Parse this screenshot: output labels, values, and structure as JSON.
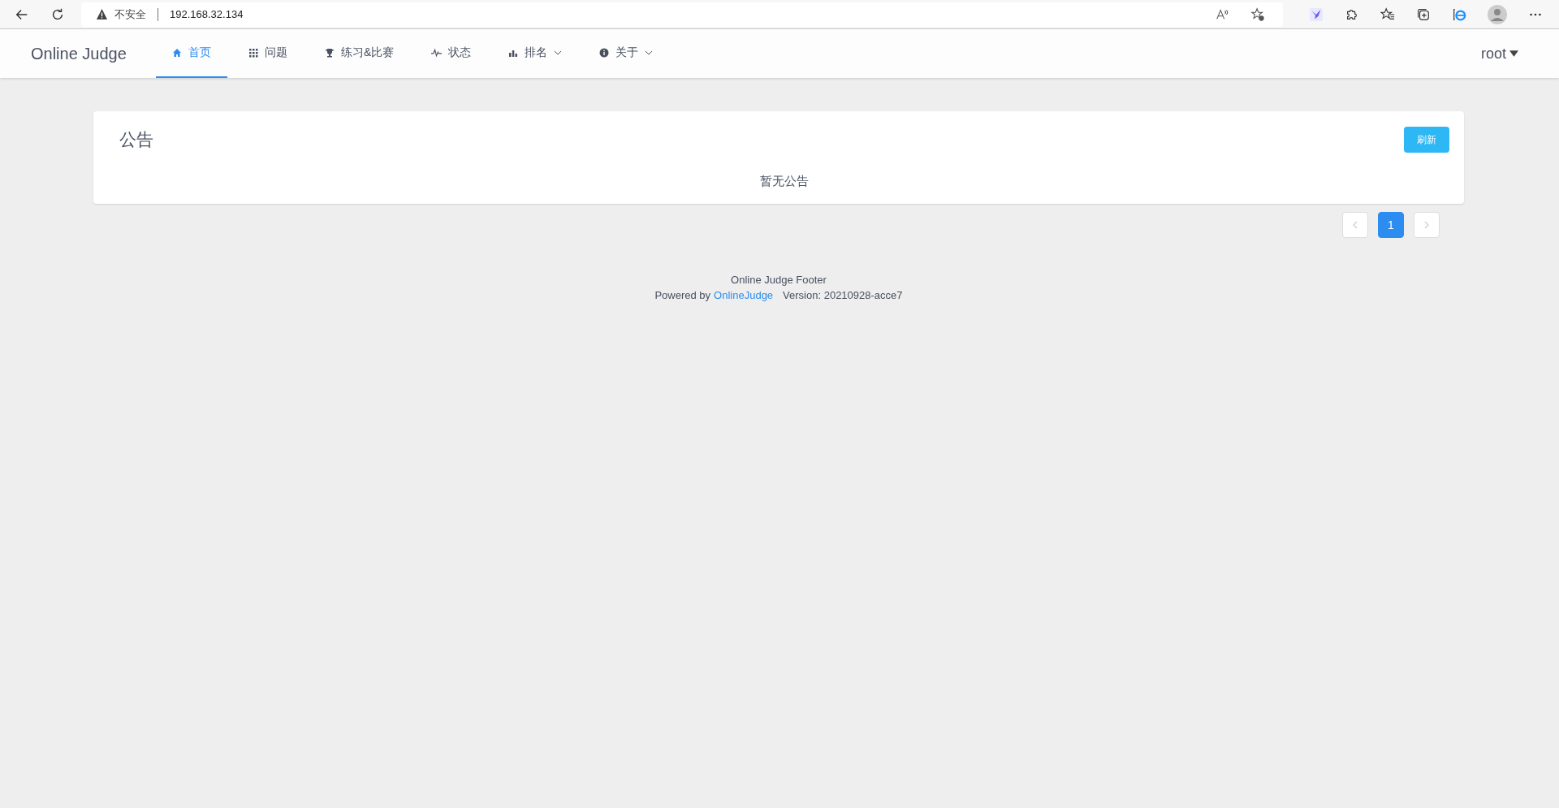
{
  "browser": {
    "security": "不安全",
    "url": "192.168.32.134"
  },
  "nav": {
    "brand": "Online Judge",
    "items": [
      {
        "label": "首页",
        "kind": "home",
        "selected": true,
        "dropdown": false
      },
      {
        "label": "问题",
        "kind": "problems",
        "selected": false,
        "dropdown": false
      },
      {
        "label": "练习&比赛",
        "kind": "contests",
        "selected": false,
        "dropdown": false
      },
      {
        "label": "状态",
        "kind": "status",
        "selected": false,
        "dropdown": false
      },
      {
        "label": "排名",
        "kind": "rank",
        "selected": false,
        "dropdown": true
      },
      {
        "label": "关于",
        "kind": "about",
        "selected": false,
        "dropdown": true
      }
    ],
    "user": "root"
  },
  "announcement": {
    "title": "公告",
    "refresh": "刷新",
    "empty": "暂无公告"
  },
  "pagination": {
    "pages": [
      {
        "label": "1",
        "selected": true
      }
    ]
  },
  "footer": {
    "line1": "Online Judge Footer",
    "powered": "Powered by",
    "link": "OnlineJudge",
    "version": "Version: 20210928-acce7"
  }
}
